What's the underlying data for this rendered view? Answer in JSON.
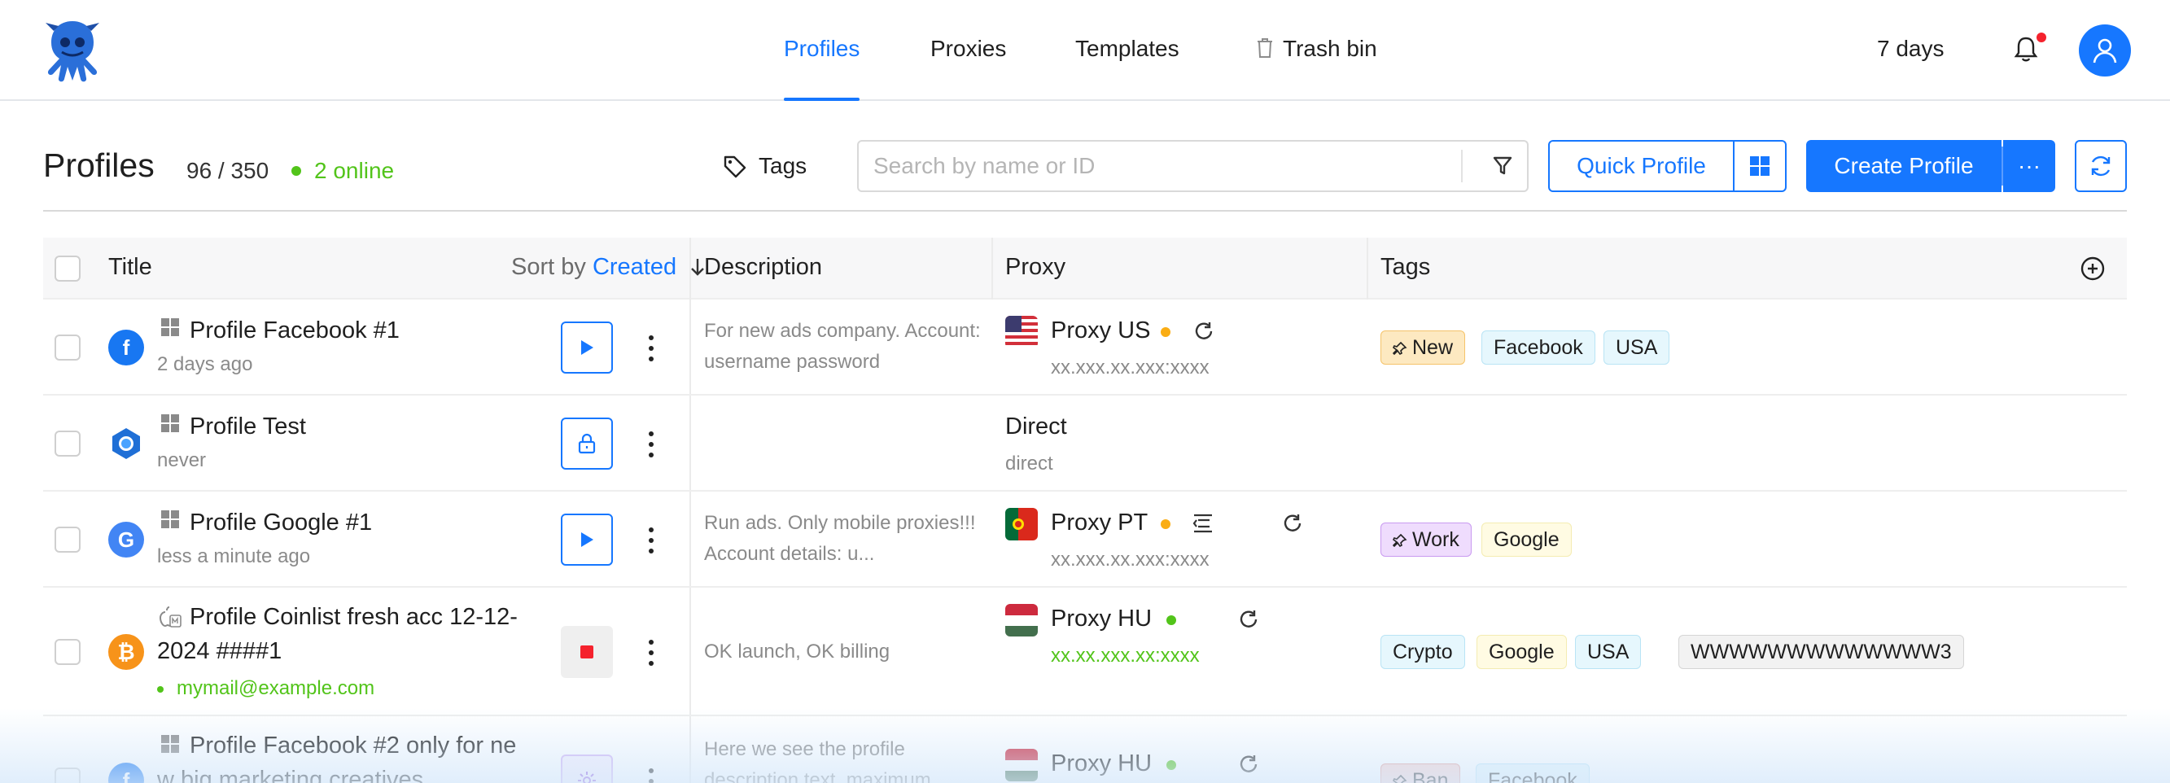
{
  "nav": {
    "items": [
      "Profiles",
      "Proxies",
      "Templates",
      "Trash bin"
    ],
    "active": "Profiles"
  },
  "subscription": {
    "days_left": "7 days"
  },
  "header": {
    "title": "Profiles",
    "count": "96 / 350",
    "online": "2 online",
    "tags_label": "Tags",
    "search_placeholder": "Search by name or ID",
    "quick_profile": "Quick Profile",
    "create_profile": "Create Profile",
    "more_label": "···"
  },
  "table": {
    "columns": {
      "title": "Title",
      "description": "Description",
      "proxy": "Proxy",
      "tags": "Tags"
    },
    "sort": {
      "prefix": "Sort by",
      "field": "Created"
    },
    "rows": [
      {
        "title": "Profile Facebook #1",
        "sub": "2 days ago",
        "app": "facebook-icon",
        "action": "play",
        "description": "For new ads company. Account: username password",
        "proxy_name": "Proxy US",
        "proxy_addr": "xx.xxx.xx.xxx:xxxx",
        "proxy_status": "#faad14",
        "tags": [
          "New",
          "Facebook",
          "USA"
        ]
      },
      {
        "title": "Profile Test",
        "sub": "never",
        "app": "chromium-icon",
        "action": "lock",
        "description": "",
        "proxy_name": "Direct",
        "proxy_addr": "direct",
        "tags": []
      },
      {
        "title": "Profile Google #1",
        "sub": "less a minute ago",
        "app": "google-icon",
        "action": "play",
        "description": "Run ads. Only mobile proxies!!! Account details: u...",
        "proxy_name": "Proxy PT",
        "proxy_addr": "xx.xxx.xx.xxx:xxxx",
        "proxy_status": "#faad14",
        "tags": [
          "Work",
          "Google"
        ]
      },
      {
        "title_line1": "Profile Coinlist fresh acc 12-12-",
        "title_line2": "2024  ####1",
        "sub": "mymail@example.com",
        "app": "bitcoin-icon",
        "action": "stop",
        "description": "OK launch, OK billing",
        "proxy_name": "Proxy HU",
        "proxy_addr": "xx.xx.xxx.xx:xxxx",
        "proxy_status": "#52c41a",
        "tags": [
          "Crypto",
          "Google",
          "USA",
          "WWWWWWWWWWWWW3"
        ]
      },
      {
        "title_line1": "Profile Facebook #2 only for ne",
        "title_line2": "w big marketing creatives",
        "app": "facebook-icon",
        "action": "settings",
        "description": "Here we see the profile description text, maximum",
        "proxy_name": "Proxy HU",
        "proxy_status": "#52c41a",
        "tags": [
          "Ban",
          "Facebook"
        ]
      }
    ]
  }
}
